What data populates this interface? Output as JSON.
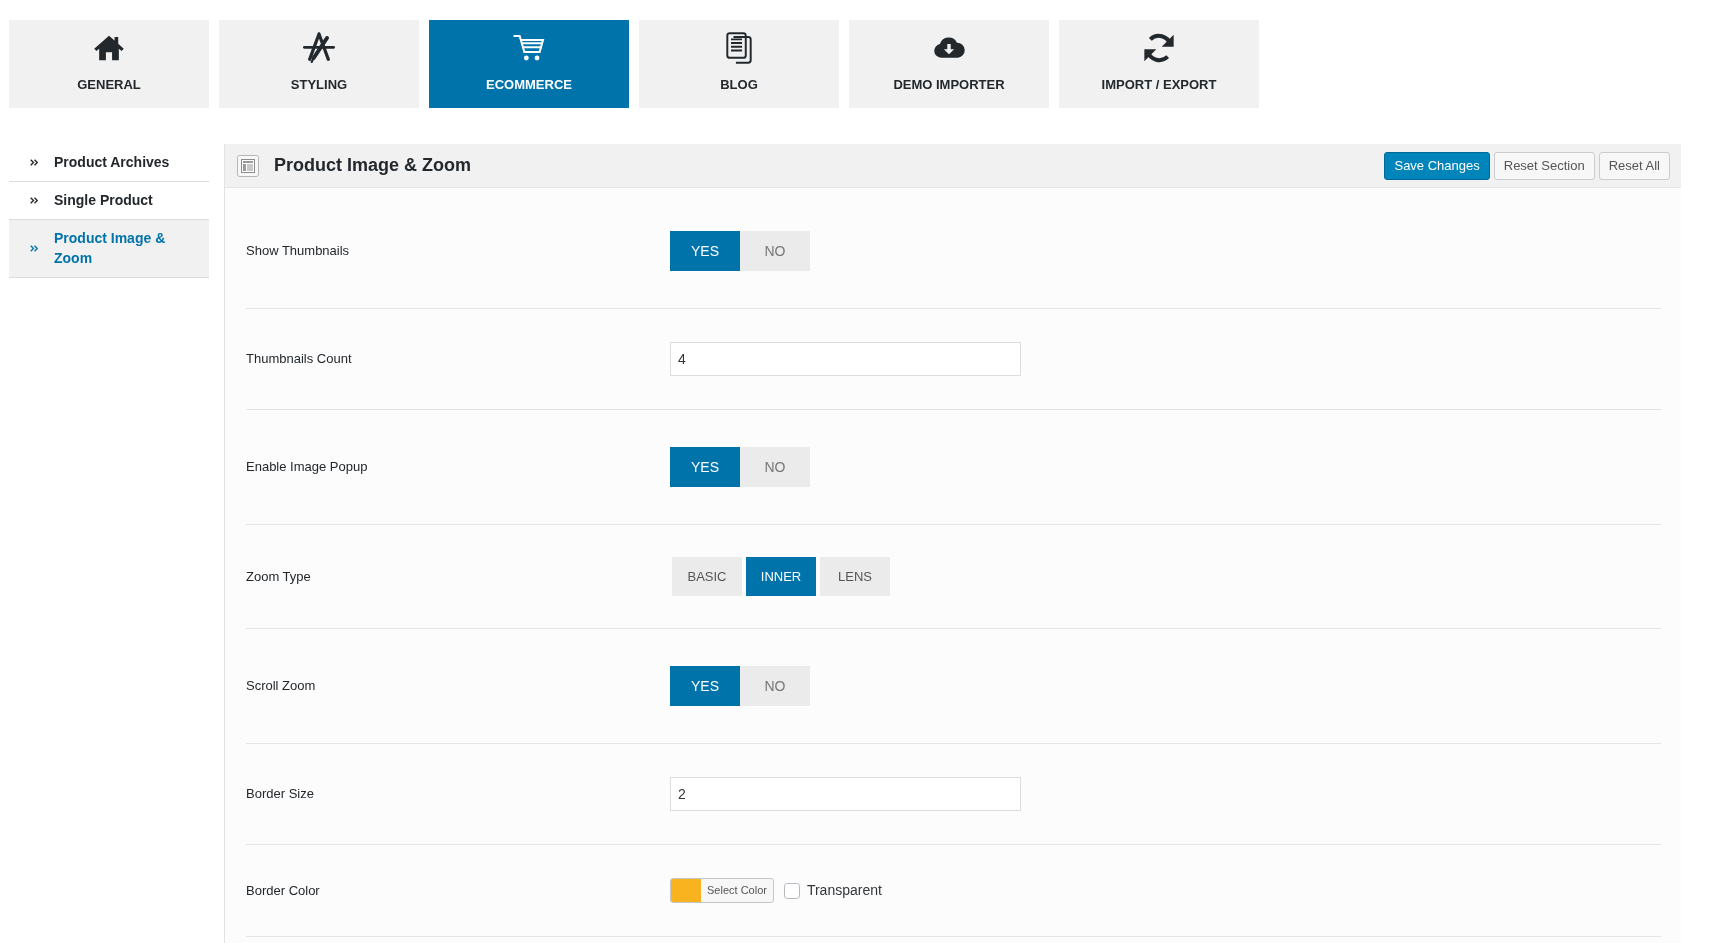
{
  "tabs": [
    {
      "label": "GENERAL",
      "selected": false
    },
    {
      "label": "STYLING",
      "selected": false
    },
    {
      "label": "ECOMMERCE",
      "selected": true
    },
    {
      "label": "BLOG",
      "selected": false
    },
    {
      "label": "DEMO IMPORTER",
      "selected": false
    },
    {
      "label": "IMPORT / EXPORT",
      "selected": false
    }
  ],
  "sidebar": {
    "items": [
      {
        "label": "Product Archives",
        "selected": false
      },
      {
        "label": "Single Product",
        "selected": false
      },
      {
        "label": "Product Image & Zoom",
        "selected": true
      }
    ]
  },
  "panel": {
    "title": "Product Image & Zoom",
    "buttons": [
      {
        "label": "Save Changes",
        "kind": "primary"
      },
      {
        "label": "Reset Section",
        "kind": "secondary"
      },
      {
        "label": "Reset All",
        "kind": "secondary"
      }
    ]
  },
  "fields": [
    {
      "kind": "toggle",
      "label": "Show Thumbnails",
      "options": [
        {
          "label": "YES",
          "selected": true
        },
        {
          "label": "NO",
          "selected": false
        }
      ]
    },
    {
      "kind": "text",
      "label": "Thumbnails Count",
      "value": "4"
    },
    {
      "kind": "toggle",
      "label": "Enable Image Popup",
      "options": [
        {
          "label": "YES",
          "selected": true
        },
        {
          "label": "NO",
          "selected": false
        }
      ]
    },
    {
      "kind": "buttonset",
      "label": "Zoom Type",
      "options": [
        {
          "label": "BASIC",
          "selected": false
        },
        {
          "label": "INNER",
          "selected": true
        },
        {
          "label": "LENS",
          "selected": false
        }
      ]
    },
    {
      "kind": "toggle",
      "label": "Scroll Zoom",
      "options": [
        {
          "label": "YES",
          "selected": true
        },
        {
          "label": "NO",
          "selected": false
        }
      ]
    },
    {
      "kind": "text",
      "label": "Border Size",
      "value": "2"
    },
    {
      "kind": "color",
      "label": "Border Color",
      "color": "#f8b31f",
      "button": "Select Color",
      "checkbox": {
        "label": "Transparent",
        "checked": false
      }
    }
  ]
}
